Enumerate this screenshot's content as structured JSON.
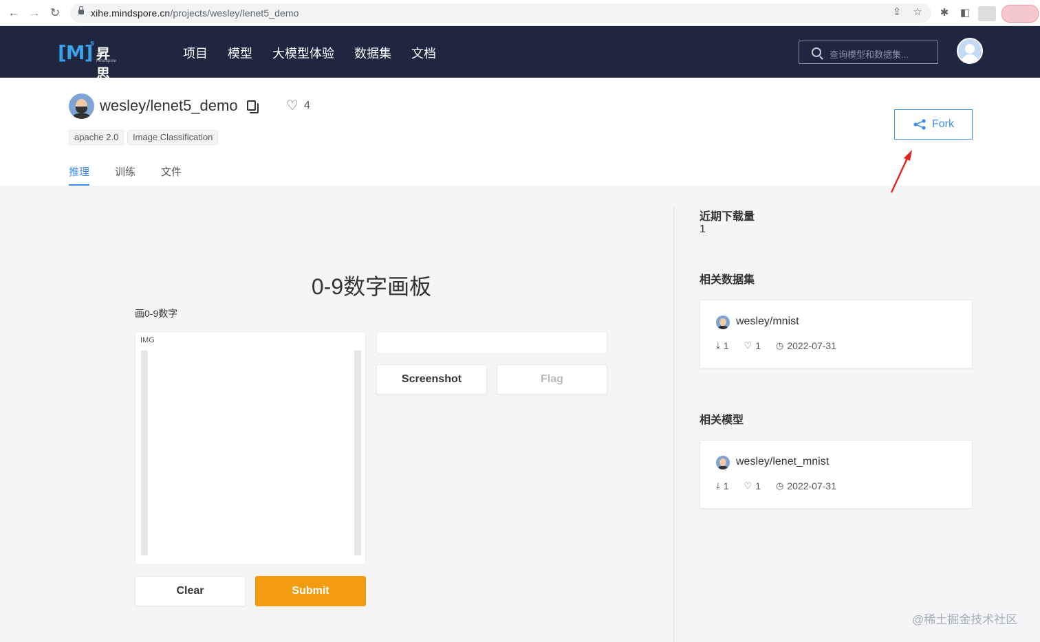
{
  "browser": {
    "back_icon": "←",
    "forward_icon": "→",
    "reload_icon": "↻",
    "url_host": "xihe.mindspore.cn",
    "url_path": "/projects/wesley/lenet5_demo",
    "share_icon": "⇪",
    "star_icon": "☆",
    "extensions_icon": "✱",
    "sidepanel_icon": "◧"
  },
  "header": {
    "logo_mark": "[M]",
    "logo_sup": "s",
    "logo_cn": "昇思",
    "logo_en": "MindSpore",
    "nav": [
      "项目",
      "模型",
      "大模型体验",
      "数据集",
      "文档"
    ],
    "search_placeholder": "查询模型和数据集..."
  },
  "project": {
    "title": "wesley/lenet5_demo",
    "likes": "4",
    "tags": [
      "apache 2.0",
      "Image Classification"
    ],
    "tabs": [
      "推理",
      "训练",
      "文件"
    ],
    "active_tab": "推理",
    "fork_label": "Fork",
    "accent_color": "#3b8ce8"
  },
  "demo": {
    "title": "0-9数字画板",
    "description": "画0-9数字",
    "input_label": "IMG",
    "screenshot_label": "Screenshot",
    "flag_label": "Flag",
    "clear_label": "Clear",
    "submit_label": "Submit",
    "submit_color": "#f29c0f"
  },
  "sidebar": {
    "downloads_heading": "近期下载量",
    "downloads_value": "1",
    "datasets_heading": "相关数据集",
    "models_heading": "相关模型",
    "datasets": [
      {
        "name": "wesley/mnist",
        "downloads": "1",
        "likes": "1",
        "date": "2022-07-31"
      }
    ],
    "models": [
      {
        "name": "wesley/lenet_mnist",
        "downloads": "1",
        "likes": "1",
        "date": "2022-07-31"
      }
    ]
  },
  "watermark": "@稀土掘金技术社区"
}
